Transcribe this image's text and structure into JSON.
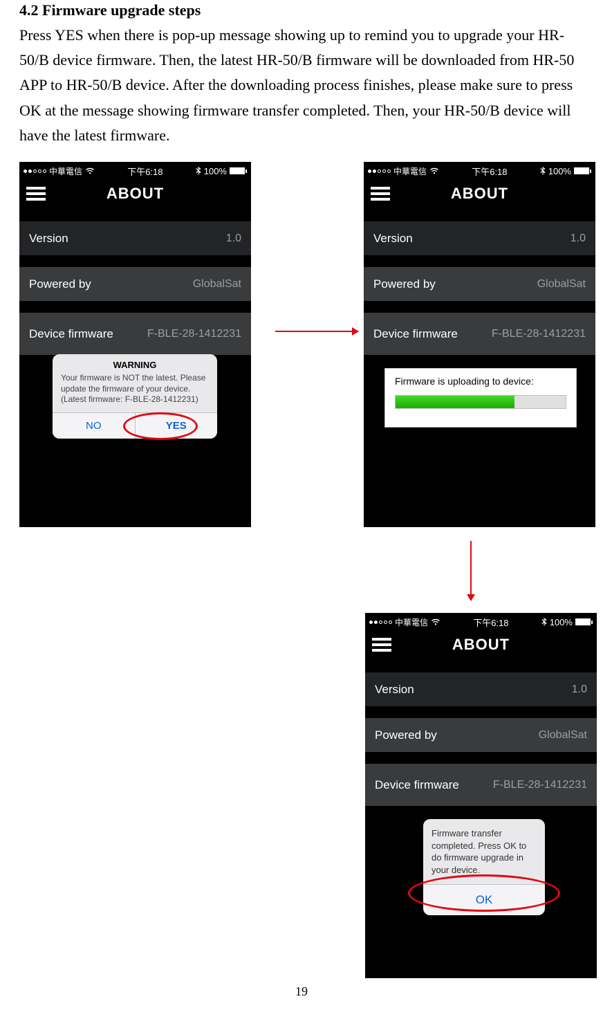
{
  "document": {
    "section_title": "4.2 Firmware upgrade steps",
    "body_text": "Press YES when there is pop-up message showing up to remind you to upgrade your HR-50/B device firmware. Then, the latest HR-50/B firmware will be downloaded from HR-50 APP to HR-50/B device. After the downloading process finishes, please make sure to press OK at the message showing firmware transfer completed. Then, your HR-50/B device will have the latest firmware.",
    "page_number": "19"
  },
  "status_bar": {
    "carrier": "中華電信",
    "time": "下午6:18",
    "battery": "100%"
  },
  "app": {
    "title": "ABOUT",
    "version_label": "Version",
    "version_value": "1.0",
    "powered_label": "Powered by",
    "powered_value": "GlobalSat",
    "firmware_label": "Device firmware",
    "firmware_value": "F-BLE-28-1412231"
  },
  "warning_dialog": {
    "title": "WARNING",
    "body": "Your firmware is NOT the latest. Please update the firmware of your device. (Latest firmware: F-BLE-28-1412231)",
    "no": "NO",
    "yes": "YES"
  },
  "progress": {
    "text": "Firmware is uploading to device:"
  },
  "complete_dialog": {
    "body": "Firmware transfer completed. Press OK to do firmware upgrade in your device.",
    "ok": "OK"
  }
}
